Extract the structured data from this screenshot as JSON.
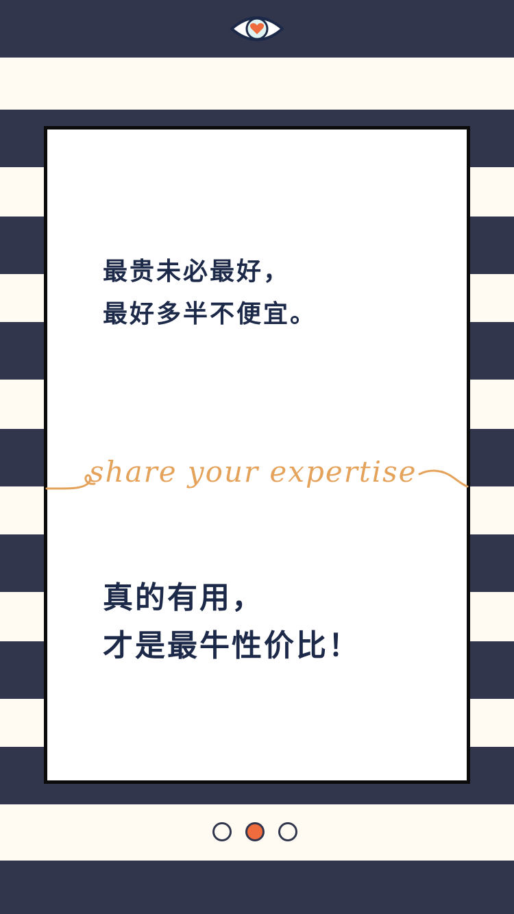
{
  "colors": {
    "stripe_dark": "#31364d",
    "stripe_light": "#fffbf3",
    "card_background": "#ffffff",
    "card_border": "#0b0b0b",
    "text_navy": "#1c2948",
    "script_orange": "#e4a25a",
    "accent_orange": "#ef6c3e"
  },
  "header": {
    "icon": "eye-with-heart-icon"
  },
  "card": {
    "quote_top": [
      "最贵未必最好，",
      "最好多半不便宜。"
    ],
    "script_tagline": "share your expertise",
    "quote_bottom": [
      "真的有用，",
      "才是最牛性价比！"
    ]
  },
  "pager": {
    "total": 3,
    "active_index": 1
  }
}
